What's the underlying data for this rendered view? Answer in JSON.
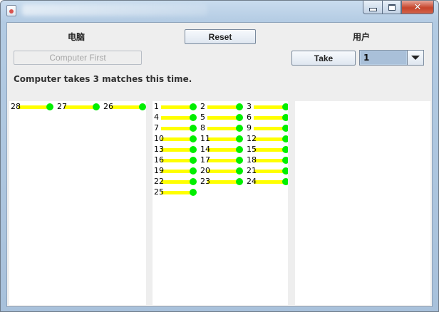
{
  "window": {
    "close_glyph": "✕"
  },
  "header": {
    "computer_label": "电脑",
    "user_label": "用户",
    "reset_label": "Reset",
    "computer_first_label": "Computer First",
    "take_label": "Take",
    "take_amount": "1"
  },
  "status": {
    "message": "Computer takes 3 matches this time."
  },
  "piles": {
    "computer": [
      "28",
      "27",
      "26"
    ],
    "remaining": [
      "1",
      "2",
      "3",
      "4",
      "5",
      "6",
      "7",
      "8",
      "9",
      "10",
      "11",
      "12",
      "13",
      "14",
      "15",
      "16",
      "17",
      "18",
      "19",
      "20",
      "21",
      "22",
      "23",
      "24",
      "25"
    ],
    "user": []
  },
  "colors": {
    "match_stick": "#ffff00",
    "match_head": "#00ee00"
  },
  "icons": {
    "app": "java-app-icon",
    "minimize": "minimize-icon",
    "maximize": "maximize-icon",
    "close": "close-icon",
    "dropdown": "chevron-down-icon"
  }
}
